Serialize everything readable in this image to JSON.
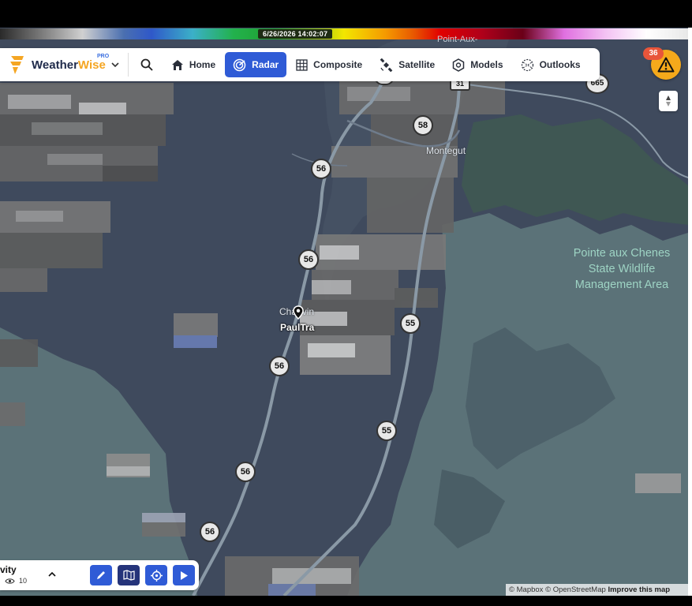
{
  "timestamp": "6/26/2026 14:02:07",
  "app": {
    "name_part1": "Weather",
    "name_part2": "Wise",
    "badge": "PRO"
  },
  "nav": {
    "home": "Home",
    "radar": "Radar",
    "composite": "Composite",
    "satellite": "Satellite",
    "models": "Models",
    "outlooks": "Outlooks"
  },
  "alerts": {
    "count": "36"
  },
  "map": {
    "places": {
      "montegut": "Montegut",
      "chauvin": "Chauvin",
      "paultra": "PaulTra",
      "point_aux": "Point-Aux-"
    },
    "area_label": {
      "line1": "Pointe aux Chenes",
      "line2": "State Wildlife",
      "line3": "Management Area"
    },
    "routes": [
      "56",
      "56",
      "56",
      "56",
      "56",
      "58",
      "55",
      "55",
      "665",
      "31",
      "56"
    ]
  },
  "layer": {
    "name": "vity",
    "viewers": "10"
  },
  "attribution": {
    "mapbox": "© Mapbox",
    "osm": "© OpenStreetMap",
    "improve": "Improve this map"
  },
  "colors": {
    "accent": "#2f5bd6",
    "alert": "#f5a91b",
    "badge": "#e8553a",
    "land": "#3f4a5d",
    "water": "#5b7278"
  }
}
